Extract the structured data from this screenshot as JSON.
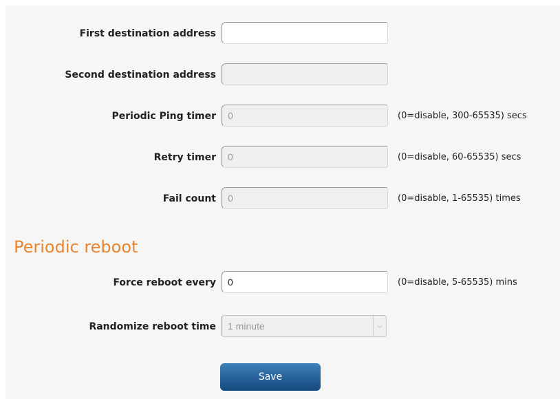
{
  "ping": {
    "first_dest": {
      "label": "First destination address",
      "value": ""
    },
    "second_dest": {
      "label": "Second destination address",
      "value": ""
    },
    "ping_timer": {
      "label": "Periodic Ping timer",
      "value": "0",
      "hint": "(0=disable, 300-65535) secs"
    },
    "retry_timer": {
      "label": "Retry timer",
      "value": "0",
      "hint": "(0=disable, 60-65535) secs"
    },
    "fail_count": {
      "label": "Fail count",
      "value": "0",
      "hint": "(0=disable, 1-65535) times"
    }
  },
  "reboot": {
    "title": "Periodic reboot",
    "force": {
      "label": "Force reboot every",
      "value": "0",
      "hint": "(0=disable, 5-65535) mins"
    },
    "randomize": {
      "label": "Randomize reboot time",
      "selected": "1 minute"
    }
  },
  "actions": {
    "save_label": "Save"
  },
  "colors": {
    "section_title": "#e9852d",
    "button": "#1f5a94",
    "panel_bg": "#f6f6f6"
  }
}
